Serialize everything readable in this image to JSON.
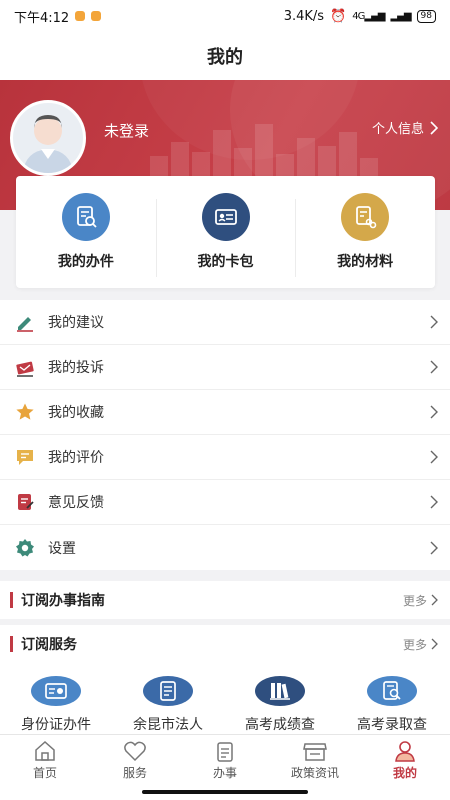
{
  "status": {
    "time": "下午4:12",
    "speed": "3.4K/s",
    "battery": "98",
    "signal": "4G"
  },
  "header": {
    "title": "我的"
  },
  "profile": {
    "login_text": "未登录",
    "info_link": "个人信息"
  },
  "quick": [
    {
      "label": "我的办件",
      "icon": "document-search-icon",
      "color": "#4a86c7"
    },
    {
      "label": "我的卡包",
      "icon": "id-card-icon",
      "color": "#2f4f7f"
    },
    {
      "label": "我的材料",
      "icon": "materials-icon",
      "color": "#d4a84a"
    }
  ],
  "menu": [
    {
      "label": "我的建议",
      "icon": "pencil-icon",
      "color": "#3d8a7a"
    },
    {
      "label": "我的投诉",
      "icon": "complaint-icon",
      "color": "#c03a44"
    },
    {
      "label": "我的收藏",
      "icon": "star-icon",
      "color": "#e8a43c"
    },
    {
      "label": "我的评价",
      "icon": "comment-icon",
      "color": "#e6b24a"
    },
    {
      "label": "意见反馈",
      "icon": "feedback-icon",
      "color": "#c03a44"
    },
    {
      "label": "设置",
      "icon": "gear-icon",
      "color": "#3d8a7a"
    }
  ],
  "sections": {
    "guide": {
      "title": "订阅办事指南",
      "more": "更多"
    },
    "service": {
      "title": "订阅服务",
      "more": "更多"
    }
  },
  "services": [
    {
      "label": "身份证办件",
      "icon": "id-card-icon",
      "color": "#4a86c7"
    },
    {
      "label": "余昆市法人",
      "icon": "document-icon",
      "color": "#3b6aa8"
    },
    {
      "label": "高考成绩查",
      "icon": "books-icon",
      "color": "#2f4f7f"
    },
    {
      "label": "高考录取查",
      "icon": "search-doc-icon",
      "color": "#4a86c7"
    }
  ],
  "tabs": [
    {
      "label": "首页",
      "icon": "home-icon",
      "active": false
    },
    {
      "label": "服务",
      "icon": "heart-icon",
      "active": false
    },
    {
      "label": "办事",
      "icon": "clipboard-icon",
      "active": false
    },
    {
      "label": "政策资讯",
      "icon": "store-icon",
      "active": false
    },
    {
      "label": "我的",
      "icon": "user-icon",
      "active": true
    }
  ],
  "colors": {
    "brand": "#c03a44",
    "hero": "#bf3a43"
  }
}
